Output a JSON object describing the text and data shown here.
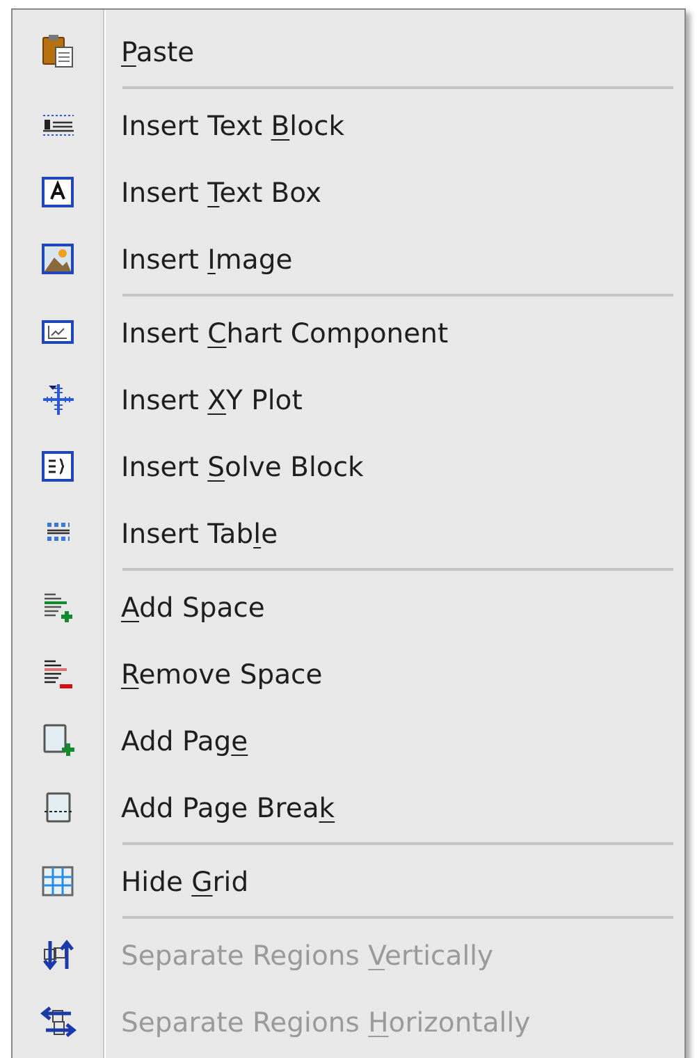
{
  "context_menu": {
    "groups": [
      {
        "items": [
          {
            "label": [
              {
                "text": "P",
                "underlined": true
              },
              {
                "text": "aste"
              }
            ],
            "disabled": false
          }
        ]
      },
      {
        "items": [
          {
            "label": [
              {
                "text": "Insert Text "
              },
              {
                "text": "B",
                "underlined": true
              },
              {
                "text": "lock"
              }
            ],
            "disabled": false
          },
          {
            "label": [
              {
                "text": "Insert "
              },
              {
                "text": "T",
                "underlined": true
              },
              {
                "text": "ext Box"
              }
            ],
            "disabled": false
          },
          {
            "label": [
              {
                "text": "Insert "
              },
              {
                "text": "I",
                "underlined": true
              },
              {
                "text": "mage"
              }
            ],
            "disabled": false
          }
        ]
      },
      {
        "items": [
          {
            "label": [
              {
                "text": "Insert "
              },
              {
                "text": "C",
                "underlined": true
              },
              {
                "text": "hart Component"
              }
            ],
            "disabled": false
          },
          {
            "label": [
              {
                "text": "Insert "
              },
              {
                "text": "X",
                "underlined": true
              },
              {
                "text": "Y Plot"
              }
            ],
            "disabled": false
          },
          {
            "label": [
              {
                "text": "Insert "
              },
              {
                "text": "S",
                "underlined": true
              },
              {
                "text": "olve Block"
              }
            ],
            "disabled": false
          },
          {
            "label": [
              {
                "text": "Insert Tab"
              },
              {
                "text": "l",
                "underlined": true
              },
              {
                "text": "e"
              }
            ],
            "disabled": false
          }
        ]
      },
      {
        "items": [
          {
            "label": [
              {
                "text": "A",
                "underlined": true
              },
              {
                "text": "dd Space"
              }
            ],
            "disabled": false
          },
          {
            "label": [
              {
                "text": "R",
                "underlined": true
              },
              {
                "text": "emove Space"
              }
            ],
            "disabled": false
          },
          {
            "label": [
              {
                "text": "Add Pag"
              },
              {
                "text": "e",
                "underlined": true
              }
            ],
            "disabled": false
          },
          {
            "label": [
              {
                "text": "Add Page Brea"
              },
              {
                "text": "k",
                "underlined": true
              }
            ],
            "disabled": false
          }
        ]
      },
      {
        "items": [
          {
            "label": [
              {
                "text": "Hide "
              },
              {
                "text": "G",
                "underlined": true
              },
              {
                "text": "rid"
              }
            ],
            "disabled": false
          }
        ]
      },
      {
        "items": [
          {
            "label": [
              {
                "text": "Separate Regions "
              },
              {
                "text": "V",
                "underlined": true
              },
              {
                "text": "ertically"
              }
            ],
            "disabled": true
          },
          {
            "label": [
              {
                "text": "Separate Regions "
              },
              {
                "text": "H",
                "underlined": true
              },
              {
                "text": "orizontally"
              }
            ],
            "disabled": true
          }
        ]
      }
    ]
  }
}
